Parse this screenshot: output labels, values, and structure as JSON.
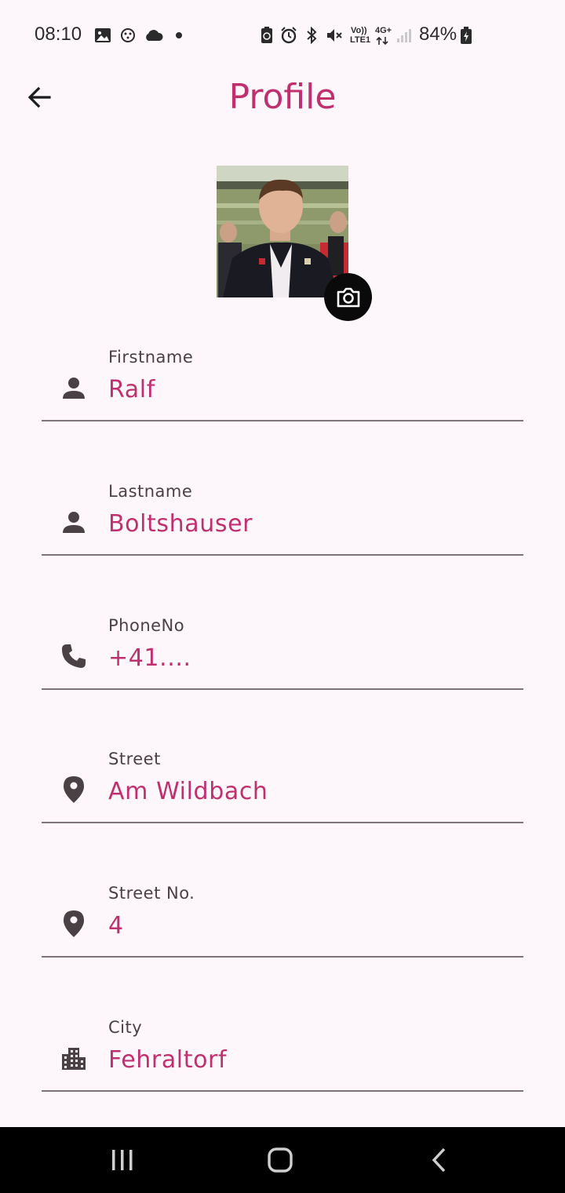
{
  "status_bar": {
    "time": "08:10",
    "battery": "84%",
    "net_top": "Vo))",
    "net_bottom": "LTE1",
    "net_4g": "4G+",
    "icons": [
      "gallery-icon",
      "app-icon",
      "cloud-icon",
      "dot-icon",
      "battery-saver-icon",
      "alarm-icon",
      "bluetooth-icon",
      "mute-icon",
      "signal-icon",
      "battery-icon"
    ]
  },
  "header": {
    "title": "Profile",
    "back_icon": "arrow-left-icon"
  },
  "avatar": {
    "camera_icon": "camera-icon"
  },
  "fields": [
    {
      "label": "Firstname",
      "value": "Ralf",
      "icon": "person-icon"
    },
    {
      "label": "Lastname",
      "value": "Boltshauser",
      "icon": "person-icon"
    },
    {
      "label": "PhoneNo",
      "value": "+41....",
      "icon": "phone-icon"
    },
    {
      "label": "Street",
      "value": "Am Wildbach",
      "icon": "location-pin-icon"
    },
    {
      "label": "Street No.",
      "value": "4",
      "icon": "location-pin-icon"
    },
    {
      "label": "City",
      "value": "Fehraltorf",
      "icon": "city-icon"
    }
  ],
  "colors": {
    "accent": "#c0306e",
    "background": "#fdf7fb",
    "text": "#4a4145",
    "divider": "#7d7378"
  },
  "nav_bar": {
    "icons": [
      "recents-icon",
      "home-icon",
      "back-icon"
    ]
  }
}
